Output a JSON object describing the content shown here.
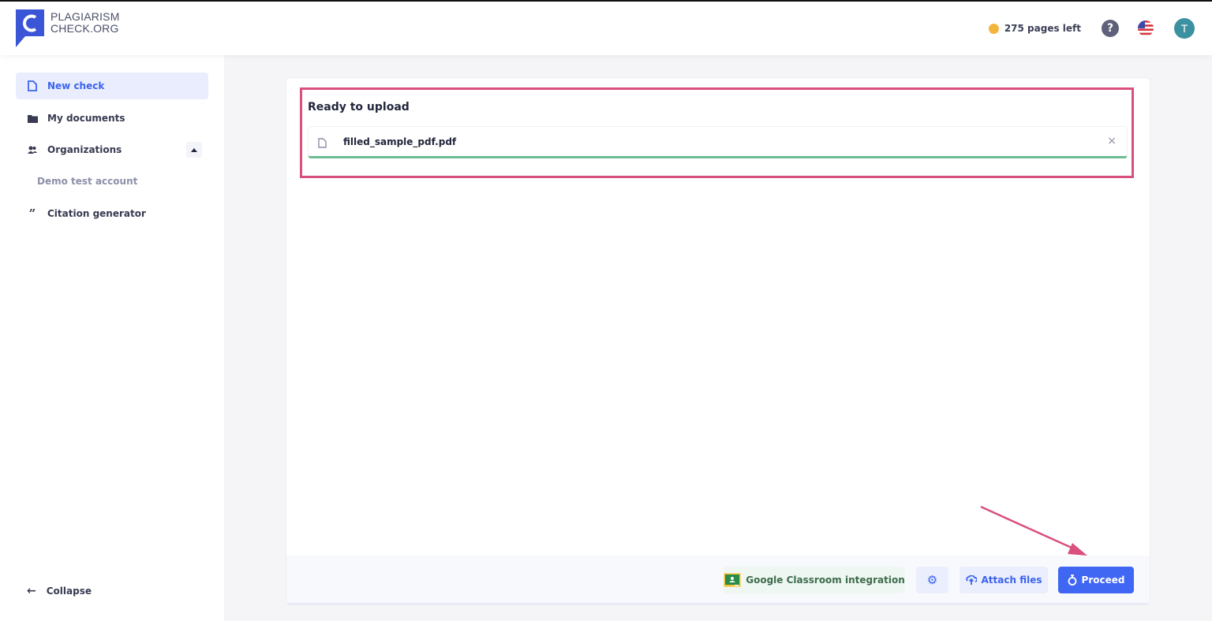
{
  "brand": {
    "line1": "PLAGIARISM",
    "line2": "CHECK.ORG",
    "color": "#3a55d6"
  },
  "header": {
    "pages_left": "275 pages left",
    "help_icon": "question-circle-icon",
    "language_icon": "us-flag-icon",
    "avatar_initial": "T"
  },
  "sidebar": {
    "items": [
      {
        "label": "New check",
        "icon": "file-icon",
        "active": true
      },
      {
        "label": "My documents",
        "icon": "folder-icon",
        "active": false
      },
      {
        "label": "Organizations",
        "icon": "users-icon",
        "active": false,
        "expanded": true
      },
      {
        "label": "Citation generator",
        "icon": "quote-icon",
        "active": false
      }
    ],
    "sub_items": [
      {
        "label": "Demo test account"
      }
    ],
    "collapse_label": "Collapse"
  },
  "upload": {
    "title": "Ready to upload",
    "files": [
      {
        "name": "filled_sample_pdf.pdf",
        "progress_percent": 100
      }
    ],
    "remove_symbol": "×"
  },
  "footer": {
    "google_classroom_label": "Google Classroom integration",
    "attach_files_label": "Attach files",
    "proceed_label": "Proceed"
  },
  "colors": {
    "accent": "#4066f4",
    "annotation": "#d94f80",
    "progress": "#6cbc92"
  }
}
